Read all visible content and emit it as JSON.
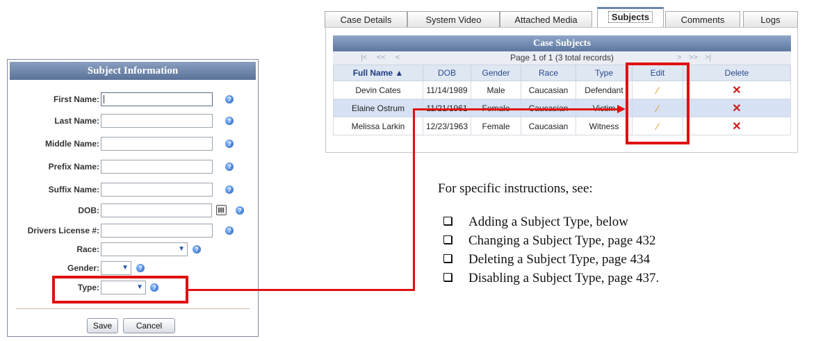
{
  "form": {
    "title": "Subject Information",
    "fields": [
      {
        "label": "First Name:",
        "value": ""
      },
      {
        "label": "Last Name:",
        "value": ""
      },
      {
        "label": "Middle Name:",
        "value": ""
      },
      {
        "label": "Prefix Name:",
        "value": ""
      },
      {
        "label": "Suffix Name:",
        "value": ""
      },
      {
        "label": "DOB:",
        "value": ""
      },
      {
        "label": "Drivers License #:",
        "value": ""
      },
      {
        "label": "Race:",
        "value": ""
      },
      {
        "label": "Gender:",
        "value": ""
      },
      {
        "label": "Type:",
        "value": ""
      }
    ],
    "save_label": "Save",
    "cancel_label": "Cancel",
    "help_glyph": "?"
  },
  "tabs": [
    {
      "label": "Case Details"
    },
    {
      "label": "System Video"
    },
    {
      "label": "Attached Media"
    },
    {
      "label": "Subjects",
      "active": true
    },
    {
      "label": "Comments"
    },
    {
      "label": "Logs"
    }
  ],
  "case_subjects": {
    "title": "Case Subjects",
    "pager_text": "Page 1 of 1 (3 total records)",
    "pager_first": "|<",
    "pager_prev_page": "<<",
    "pager_prev": "<",
    "pager_next": ">",
    "pager_next_page": ">>",
    "pager_last": ">|",
    "columns": [
      "Full Name ▲",
      "DOB",
      "Gender",
      "Race",
      "Type",
      "Edit",
      "Delete"
    ],
    "rows": [
      {
        "name": "Devin Cates",
        "dob": "11/14/1989",
        "gender": "Male",
        "race": "Caucasian",
        "type": "Defendant"
      },
      {
        "name": "Elaine Ostrum",
        "dob": "11/21/1961",
        "gender": "Female",
        "race": "Caucasian",
        "type": "Victim"
      },
      {
        "name": "Melissa Larkin",
        "dob": "12/23/1963",
        "gender": "Female",
        "race": "Caucasian",
        "type": "Witness"
      }
    ],
    "edit_glyph": "⁄",
    "delete_glyph": "✕"
  },
  "instructions": {
    "heading": "For specific instructions, see:",
    "items": [
      "Adding a Subject Type, below",
      "Changing a Subject Type, page 432",
      "Deleting a Subject Type, page 434",
      "Disabling a Subject Type, page 437."
    ]
  },
  "colors": {
    "highlight": "#e01010",
    "title_bar": "#5a7299",
    "selected_row": "#d6e1f3"
  },
  "icons": [
    "help-icon",
    "calendar-icon",
    "dropdown-arrow-icon",
    "edit-pencil-icon",
    "delete-x-icon",
    "checkbox-bullet-icon"
  ]
}
